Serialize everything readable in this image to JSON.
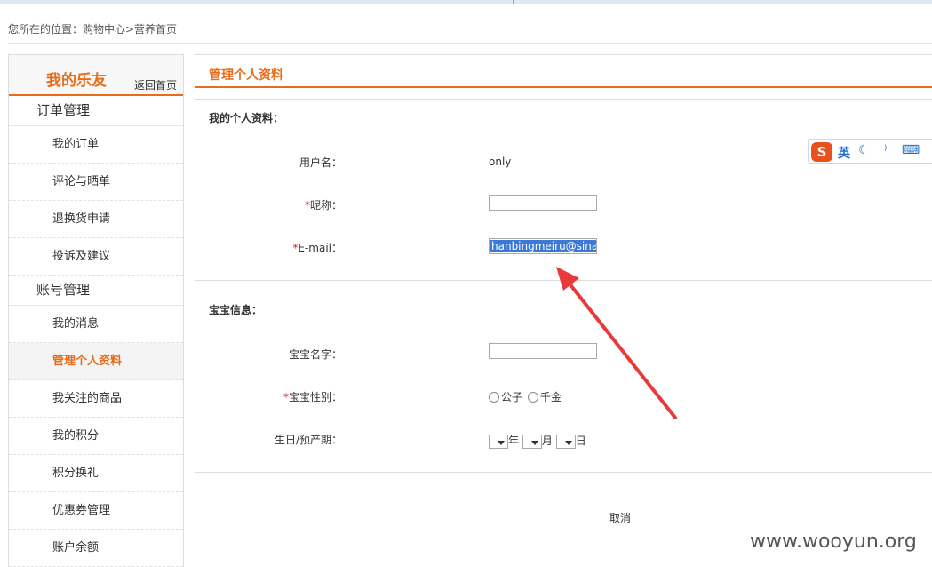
{
  "breadcrumb": "您所在的位置：购物中心>营养首页",
  "sidebar": {
    "title": "我的乐友",
    "back_link": "返回首页",
    "groups": [
      {
        "label": "订单管理",
        "items": [
          {
            "label": "我的订单"
          },
          {
            "label": "评论与晒单"
          },
          {
            "label": "退换货申请"
          },
          {
            "label": "投诉及建议"
          }
        ]
      },
      {
        "label": "账号管理",
        "items": [
          {
            "label": "我的消息"
          },
          {
            "label": "管理个人资料",
            "active": true
          },
          {
            "label": "我关注的商品"
          },
          {
            "label": "我的积分"
          },
          {
            "label": "积分换礼"
          },
          {
            "label": "优惠券管理"
          },
          {
            "label": "账户余额"
          }
        ]
      }
    ]
  },
  "main": {
    "title": "管理个人资料",
    "profile": {
      "section_title": "我的个人资料：",
      "username_label": "用户名：",
      "username_value": "only",
      "nickname_label": "昵称：",
      "nickname_value": "",
      "email_label": "E-mail：",
      "email_value": "hanbingmeiru@sina.c"
    },
    "baby": {
      "section_title": "宝宝信息：",
      "name_label": "宝宝名字：",
      "name_value": "",
      "gender_label": "宝宝性别：",
      "gender_options": [
        "公子",
        "千金"
      ],
      "birthday_label": "生日/预产期：",
      "year_unit": "年",
      "month_unit": "月",
      "day_unit": "日"
    },
    "cancel_label": "取消"
  },
  "required_mark": "*",
  "ime": {
    "logo": "S",
    "mode": "英",
    "icons": "☾ ⁾ ⌨ 👤"
  },
  "watermark": "www.wooyun.org",
  "colors": {
    "accent": "#e86c1a",
    "required": "#e02020",
    "selection": "#3b78d8",
    "arrow": "#e83a3a"
  }
}
